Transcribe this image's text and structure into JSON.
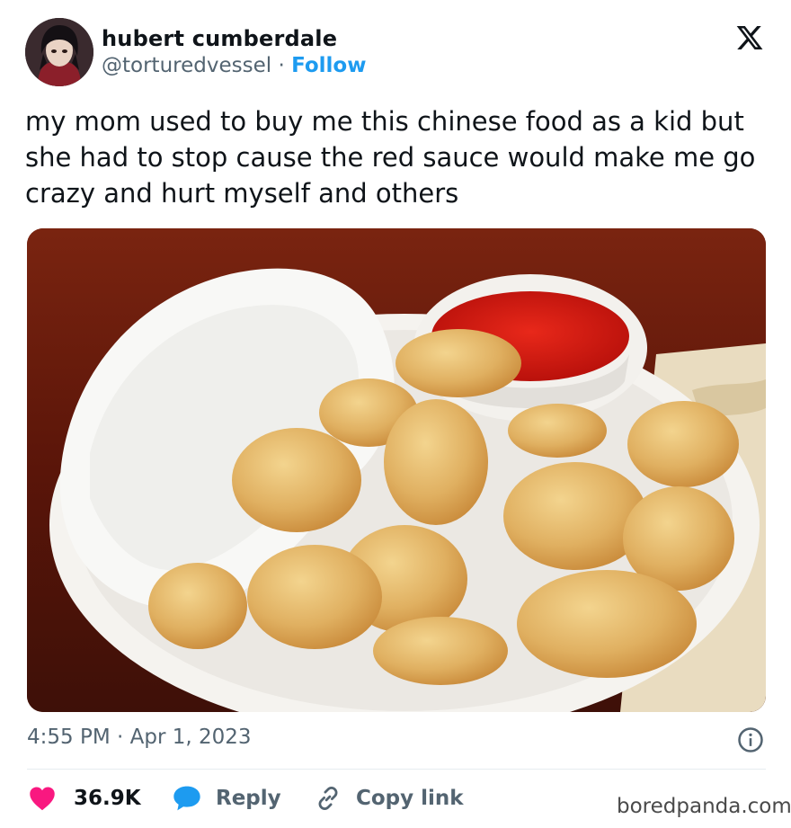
{
  "author": {
    "display_name": "hubert cumberdale",
    "handle": "@torturedvessel",
    "separator": "·",
    "follow_label": "Follow"
  },
  "tweet": {
    "text": "my mom used to buy me this chinese food as a kid but she had to stop cause the red sauce would make me go crazy and hurt myself and others",
    "time": "4:55 PM",
    "date": "Apr 1, 2023",
    "separator": "·"
  },
  "actions": {
    "likes_count": "36.9K",
    "reply_label": "Reply",
    "copy_link_label": "Copy link"
  },
  "watermark": "boredpanda.com",
  "icons": {
    "platform": "x-logo-icon",
    "info": "info-icon",
    "like": "heart-icon",
    "reply": "reply-bubble-icon",
    "copy": "link-icon"
  },
  "colors": {
    "follow": "#1d9bf0",
    "like": "#f91880",
    "reply": "#1d9bf0",
    "muted_text": "#536471"
  }
}
